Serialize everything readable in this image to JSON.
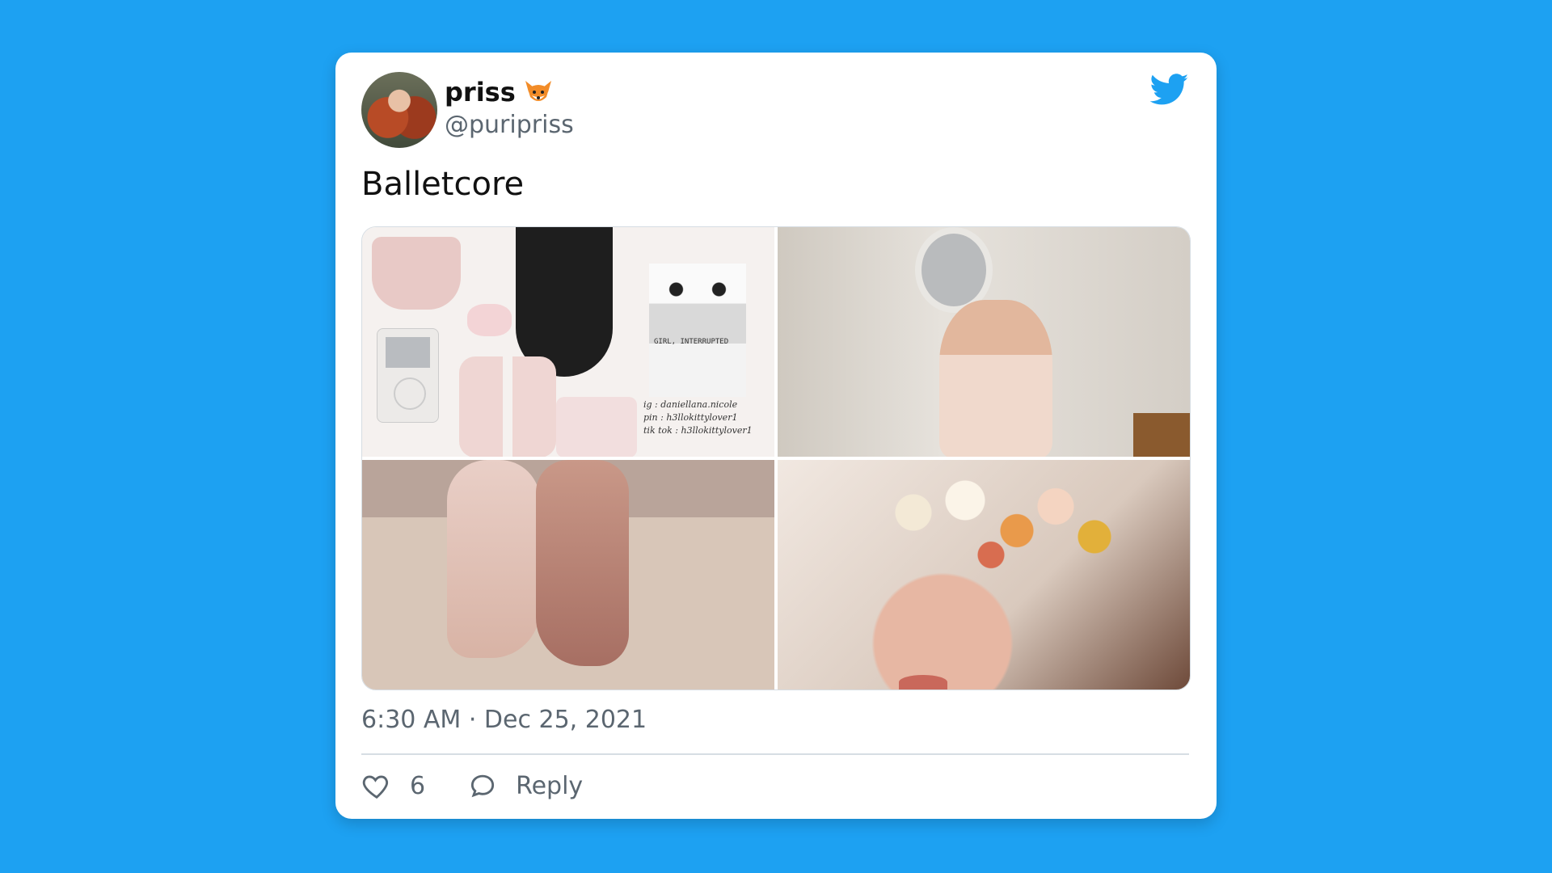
{
  "tweet": {
    "display_name": "priss",
    "name_emoji": "fox-face",
    "handle": "@puripriss",
    "text": "Balletcore",
    "timestamp": "6:30 AM · Dec 25, 2021",
    "likes": "6",
    "reply_label": "Reply",
    "image_caption_lines": [
      "ig : daniellana.nicole",
      "pin : h3llokittylover1",
      "tik tok : h3llokittylover1"
    ],
    "poster_title": "GIRL, INTERRUPTED"
  },
  "colors": {
    "background": "#1da1f2",
    "card": "#ffffff",
    "twitter_blue": "#1da1f2",
    "secondary_text": "#5b6670"
  },
  "icons": [
    "fox-emoji-icon",
    "twitter-bird-icon",
    "heart-icon",
    "reply-bubble-icon"
  ]
}
